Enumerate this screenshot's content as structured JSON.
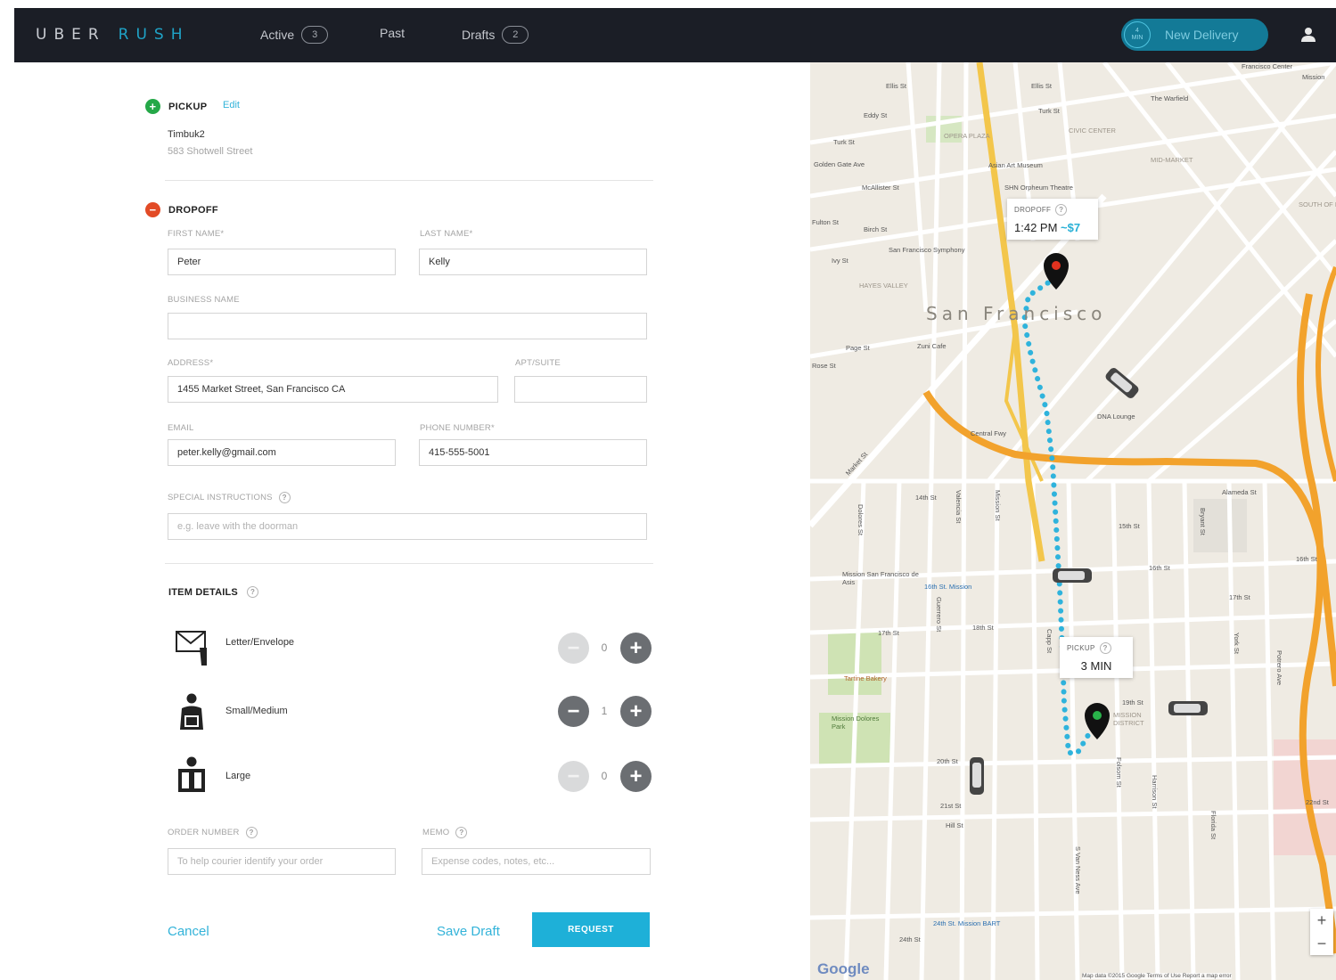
{
  "nav": {
    "logo_uber": "UBER",
    "logo_rush": "RUSH",
    "tabs": [
      {
        "label": "Active",
        "count": "3"
      },
      {
        "label": "Past"
      },
      {
        "label": "Drafts",
        "count": "2"
      }
    ],
    "new_delivery": {
      "label": "New Delivery",
      "badge_top": "4",
      "badge_bottom": "MIN"
    }
  },
  "pickup": {
    "heading": "PICKUP",
    "edit": "Edit",
    "name": "Timbuk2",
    "address": "583 Shotwell Street"
  },
  "dropoff": {
    "heading": "DROPOFF",
    "first_name_label": "FIRST NAME*",
    "first_name": "Peter",
    "last_name_label": "LAST NAME*",
    "last_name": "Kelly",
    "business_label": "BUSINESS NAME",
    "business": "",
    "address_label": "ADDRESS*",
    "address": "1455 Market Street, San Francisco CA",
    "apt_label": "APT/SUITE",
    "apt": "",
    "email_label": "EMAIL",
    "email": "peter.kelly@gmail.com",
    "phone_label": "PHONE NUMBER*",
    "phone": "415-555-5001",
    "special_label": "SPECIAL INSTRUCTIONS",
    "special_placeholder": "e.g. leave with the doorman"
  },
  "items": {
    "heading": "ITEM DETAILS",
    "list": [
      {
        "label": "Letter/Envelope",
        "qty": "0"
      },
      {
        "label": "Small/Medium",
        "qty": "1"
      },
      {
        "label": "Large",
        "qty": "0"
      }
    ]
  },
  "extra": {
    "order_label": "ORDER NUMBER",
    "order_placeholder": "To help courier identify your order",
    "memo_label": "MEMO",
    "memo_placeholder": "Expense codes, notes, etc..."
  },
  "actions": {
    "cancel": "Cancel",
    "save_draft": "Save Draft",
    "request": "REQUEST"
  },
  "map": {
    "city": "San Francisco",
    "dropoff_callout": {
      "caption": "DROPOFF",
      "time": "1:42 PM",
      "fare": "~$7"
    },
    "pickup_callout": {
      "caption": "PICKUP",
      "eta": "3 MIN"
    },
    "labels": {
      "franklin_center": "Francisco Center",
      "mission_st_top": "Mission",
      "marfield": "The Warfield",
      "ellis1": "Ellis St",
      "ellis2": "Ellis St",
      "eddy": "Eddy St",
      "turk": "Turk St",
      "turk2": "Turk St",
      "opera_plaza": "OPERA PLAZA",
      "civic_center": "CIVIC CENTER",
      "mid_market": "MID-MARKET",
      "golden_gate": "Golden Gate Ave",
      "mcallister": "McAllister St",
      "asian_art": "Asian Art Museum",
      "orpheum": "SHN Orpheum Theatre",
      "birch": "Birch St",
      "fulton": "Fulton St",
      "ivy": "Ivy St",
      "symphony": "San Francisco Symphony",
      "hayes_valley": "HAYES VALLEY",
      "south_market": "SOUTH OF MARKET",
      "page": "Page St",
      "rose": "Rose St",
      "zuni": "Zuni Cafe",
      "dna": "DNA Lounge",
      "central_fwy": "Central Fwy",
      "market": "Market St",
      "alameda": "Alameda St",
      "st14": "14th St",
      "st15": "15th St",
      "st16a": "16th St",
      "st16b": "16th St",
      "st17": "17th St",
      "st17b": "17th St",
      "st18": "18th St",
      "st19": "19th St",
      "st20": "20th St",
      "st21": "21st St",
      "st22": "22nd St",
      "st24": "24th St",
      "mission_dolores": "Mission San Francisco de Asis",
      "bart16": "16th St. Mission",
      "bart24": "24th St. Mission BART",
      "tartine": "Tartine Bakery",
      "dolores_park": "Mission Dolores Park",
      "mission_district": "MISSION DISTRICT",
      "hill": "Hill St",
      "valencia": "Valencia St",
      "guerrero": "Guerrero St",
      "dolores": "Dolores St",
      "mission_st": "Mission St",
      "capp": "Capp St",
      "van_ness": "S Van Ness Ave",
      "folsom": "Folsom St",
      "harrison": "Harrison St",
      "bryant": "Bryant St",
      "florida": "Florida St",
      "york": "York St",
      "potrero": "Potrero Ave"
    },
    "google": "Google",
    "attribution": "Map data ©2015 Google   Terms of Use   Report a map error",
    "zoom_in": "+",
    "zoom_out": "−"
  }
}
